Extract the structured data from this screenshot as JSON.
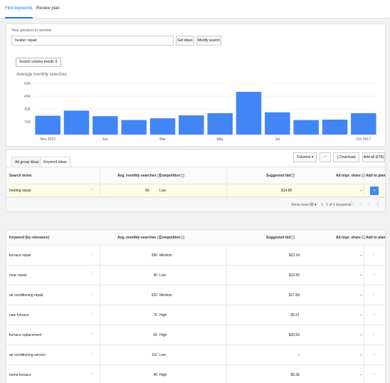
{
  "tabs": {
    "find": "Find keywords",
    "review": "Review plan"
  },
  "search": {
    "label": "Your product or service",
    "value": "heater repair",
    "get_ideas": "Get ideas",
    "modify": "Modify search"
  },
  "chart_selector": "Search volume trends",
  "chart_data": {
    "type": "bar",
    "title": "Average monthly searches",
    "categories": [
      "Nov 2016",
      "Dec 2016",
      "Jan",
      "Feb",
      "Mar",
      "Apr",
      "May",
      "Jun",
      "Jul",
      "Aug",
      "Sep",
      "Oct 2017"
    ],
    "tick_labels": [
      "Nov 2016",
      "Jan",
      "Mar",
      "May",
      "Jul",
      "Oct 2017"
    ],
    "values": [
      22000,
      28000,
      21500,
      17000,
      19000,
      22500,
      25000,
      50000,
      26000,
      17000,
      17500,
      25000
    ],
    "yticks": [
      "60K",
      "45K",
      "30K",
      "15K"
    ],
    "ylim": [
      0,
      60000
    ],
    "color": "#4285f4"
  },
  "subtabs": {
    "ad_group": "Ad group ideas",
    "keyword": "Keyword ideas"
  },
  "toolbar": {
    "columns": "Columns ▾",
    "download": "Download",
    "add_all": "Add all (678)"
  },
  "search_terms": {
    "headers": {
      "term": "Search terms",
      "avg": "Avg. monthly searches",
      "comp": "Competition",
      "bid": "Suggested bid",
      "share": "Ad impr. share",
      "add": "Add to plan"
    },
    "rows": [
      {
        "term": "heating repair",
        "avg": "90",
        "comp": "Low",
        "bid": "$14.85",
        "share": "–"
      }
    ]
  },
  "pager": {
    "show_rows": "Show rows:",
    "rows": "30 ▾",
    "range": "1 - 1 of 1 keywords"
  },
  "keywords": {
    "headers": {
      "term": "Keyword (by relevance)",
      "avg": "Avg. monthly searches",
      "comp": "Competition",
      "bid": "Suggested bid",
      "share": "Ad impr. share",
      "add": "Add to plan"
    },
    "rows": [
      {
        "term": "furnace repair",
        "avg": "390",
        "comp": "Medium",
        "bid": "$23.34",
        "share": "–"
      },
      {
        "term": "hvac repair",
        "avg": "90",
        "comp": "Low",
        "bid": "$16.50",
        "share": "–"
      },
      {
        "term": "air conditioning repair",
        "avg": "320",
        "comp": "Medium",
        "bid": "$17.68",
        "share": "–"
      },
      {
        "term": "new furnace",
        "avg": "70",
        "comp": "High",
        "bid": "$5.51",
        "share": "–"
      },
      {
        "term": "furnace replacement",
        "avg": "50",
        "comp": "High",
        "bid": "$20.69",
        "share": "–"
      },
      {
        "term": "air conditioning service",
        "avg": "110",
        "comp": "Low",
        "bid": "–",
        "share": "–"
      },
      {
        "term": "home furnace",
        "avg": "40",
        "comp": "High",
        "bid": "$6.36",
        "share": "–"
      }
    ]
  }
}
